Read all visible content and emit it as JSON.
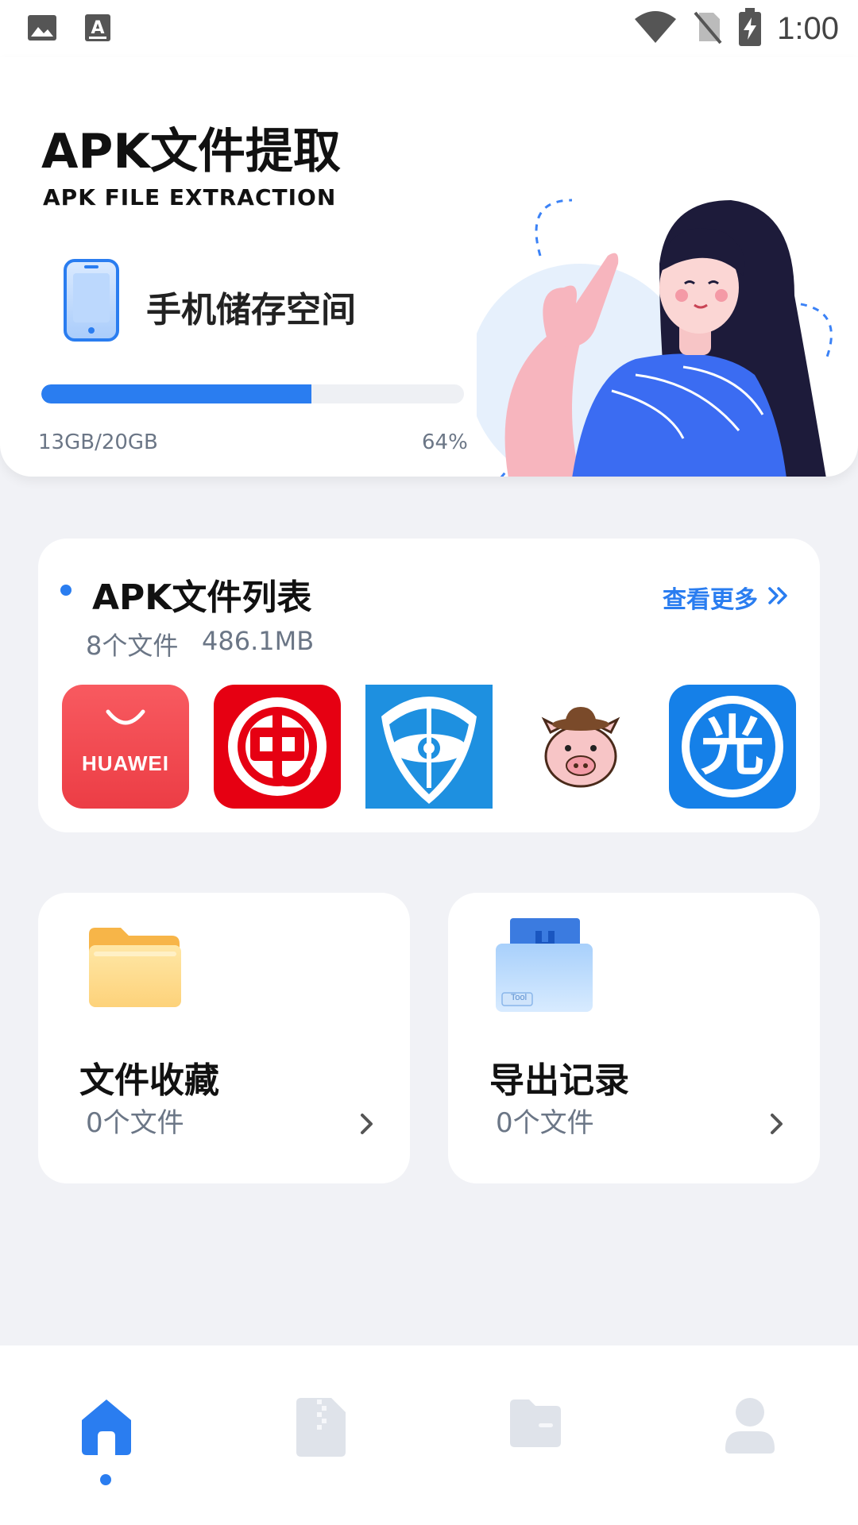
{
  "status_bar": {
    "time": "1:00",
    "left_icons": [
      "image-icon",
      "text-icon"
    ],
    "right_icons": [
      "wifi-icon",
      "no-sim-icon",
      "battery-charging-icon"
    ]
  },
  "hero": {
    "title": "APK文件提取",
    "subtitle": "APK FILE EXTRACTION",
    "storage_label": "手机储存空间",
    "storage_used": "13GB/20GB",
    "storage_percent": "64%",
    "storage_fraction": 0.64
  },
  "apk_list": {
    "title": "APK文件列表",
    "file_count": "8个文件",
    "total_size": "486.1MB",
    "more_label": "查看更多",
    "apps": [
      {
        "name": "huawei-appgallery-icon",
        "text": "HUAWEI",
        "color": "#f04a52"
      },
      {
        "name": "red-bug-app-icon",
        "text": "",
        "color": "#e60012"
      },
      {
        "name": "blue-atom-app-icon",
        "text": "",
        "color": "#1e90e0"
      },
      {
        "name": "pig-cowboy-app-icon",
        "text": "",
        "color": "#ffffff"
      },
      {
        "name": "light-app-icon",
        "text": "光",
        "color": "#1580e8"
      }
    ]
  },
  "favorites": {
    "title": "文件收藏",
    "count": "0个文件"
  },
  "export_records": {
    "title": "导出记录",
    "count": "0个文件",
    "tool_tag": "Tool"
  },
  "bottom_nav": {
    "items": [
      "home-icon",
      "zip-file-icon",
      "folder-icon",
      "user-icon"
    ],
    "active_index": 0
  },
  "colors": {
    "accent": "#2a7df0",
    "background": "#f1f2f6",
    "muted_text": "#6b7686",
    "nav_inactive": "#dfe3ea"
  }
}
